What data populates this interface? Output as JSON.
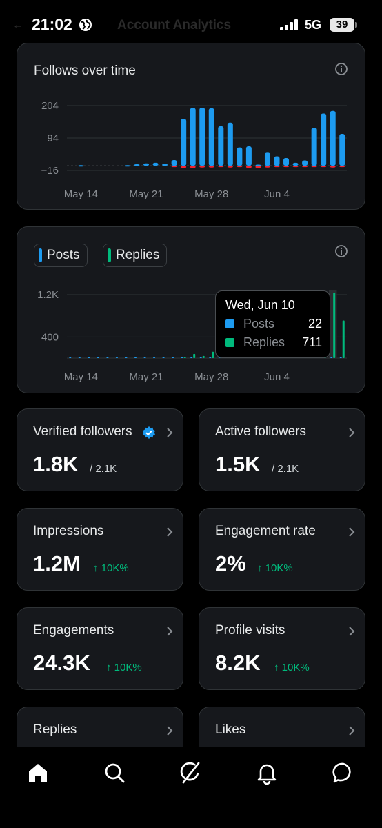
{
  "status_bar": {
    "time": "21:02",
    "network": "5G",
    "battery": "39",
    "obscured_title": "Account Analytics"
  },
  "follows_card": {
    "title": "Follows over time",
    "icon": "info-icon",
    "chart_data": {
      "type": "bar",
      "title": "Follows over time",
      "y_ticks": [
        "204",
        "94",
        "−16"
      ],
      "ylim": [
        -16,
        204
      ],
      "x_ticks": [
        "May 14",
        "May 21",
        "May 28",
        "Jun 4"
      ],
      "dates": [
        "May 13",
        "May 14",
        "May 15",
        "May 16",
        "May 17",
        "May 18",
        "May 19",
        "May 20",
        "May 21",
        "May 22",
        "May 23",
        "May 24",
        "May 25",
        "May 26",
        "May 27",
        "May 28",
        "May 29",
        "May 30",
        "May 31",
        "Jun 1",
        "Jun 2",
        "Jun 3",
        "Jun 4",
        "Jun 5",
        "Jun 6",
        "Jun 7",
        "Jun 8",
        "Jun 9",
        "Jun 10",
        "Jun 11"
      ],
      "series": [
        {
          "color": "#1d9bf0",
          "values": [
            0,
            2,
            0,
            0,
            0,
            0,
            2,
            5,
            8,
            10,
            6,
            19,
            159,
            196,
            197,
            195,
            134,
            146,
            62,
            66,
            4,
            44,
            32,
            26,
            10,
            18,
            129,
            177,
            186,
            108
          ]
        },
        {
          "color": "#f4212e",
          "values": [
            0,
            0,
            0,
            0,
            0,
            0,
            0,
            0,
            0,
            0,
            0,
            -4,
            -8,
            -8,
            -6,
            -6,
            -4,
            -6,
            -4,
            -8,
            -8,
            -6,
            -4,
            -4,
            -4,
            -4,
            -4,
            -4,
            -6,
            -4
          ]
        }
      ],
      "grid": true
    }
  },
  "replies_card": {
    "legend": [
      {
        "label": "Posts",
        "color": "#1d9bf0"
      },
      {
        "label": "Replies",
        "color": "#00ba7c"
      }
    ],
    "icon": "info-icon",
    "tooltip": {
      "date": "Wed, Jun 10",
      "rows": [
        {
          "label": "Posts",
          "value": "22",
          "color": "#1d9bf0"
        },
        {
          "label": "Replies",
          "value": "711",
          "color": "#00ba7c"
        }
      ]
    },
    "chart_data": {
      "type": "bar",
      "y_ticks": [
        "1.2K",
        "400"
      ],
      "ylim": [
        0,
        1200
      ],
      "x_ticks": [
        "May 14",
        "May 21",
        "May 28",
        "Jun 4"
      ],
      "dates": [
        "May 13",
        "May 14",
        "May 15",
        "May 16",
        "May 17",
        "May 18",
        "May 19",
        "May 20",
        "May 21",
        "May 22",
        "May 23",
        "May 24",
        "May 25",
        "May 26",
        "May 27",
        "May 28",
        "May 29",
        "May 30",
        "May 31",
        "Jun 1",
        "Jun 2",
        "Jun 3",
        "Jun 4",
        "Jun 5",
        "Jun 6",
        "Jun 7",
        "Jun 8",
        "Jun 9",
        "Jun 10",
        "Jun 11"
      ],
      "series": [
        {
          "name": "Posts",
          "color": "#1d9bf0",
          "values": [
            4,
            6,
            3,
            4,
            5,
            6,
            4,
            8,
            10,
            6,
            5,
            8,
            12,
            10,
            15,
            12,
            10,
            14,
            16,
            8,
            10,
            12,
            14,
            15,
            16,
            12,
            14,
            18,
            22,
            20
          ]
        },
        {
          "name": "Replies",
          "color": "#00ba7c",
          "values": [
            0,
            0,
            0,
            0,
            0,
            0,
            0,
            0,
            0,
            0,
            0,
            0,
            20,
            80,
            40,
            120,
            60,
            220,
            40,
            30,
            30,
            30,
            30,
            30,
            30,
            30,
            20,
            20,
            1240,
            711
          ]
        }
      ],
      "highlight_index": 28,
      "grid": true
    }
  },
  "metrics": [
    {
      "title": "Verified followers",
      "value": "1.8K",
      "sub": "/ 2.1K",
      "change": "",
      "verified": true
    },
    {
      "title": "Active followers",
      "value": "1.5K",
      "sub": "/ 2.1K",
      "change": "",
      "verified": false
    },
    {
      "title": "Impressions",
      "value": "1.2M",
      "sub": "",
      "change": "↑ 10K%",
      "verified": false
    },
    {
      "title": "Engagement rate",
      "value": "2%",
      "sub": "",
      "change": "↑ 10K%",
      "verified": false
    },
    {
      "title": "Engagements",
      "value": "24.3K",
      "sub": "",
      "change": "↑ 10K%",
      "verified": false
    },
    {
      "title": "Profile visits",
      "value": "8.2K",
      "sub": "",
      "change": "↑ 10K%",
      "verified": false
    },
    {
      "title": "Replies",
      "value": "",
      "sub": "",
      "change": "",
      "verified": false
    },
    {
      "title": "Likes",
      "value": "",
      "sub": "",
      "change": "",
      "verified": false
    }
  ],
  "bottom_nav": [
    {
      "name": "home",
      "icon": "home-icon",
      "active": true
    },
    {
      "name": "search",
      "icon": "search-icon",
      "active": false
    },
    {
      "name": "grok",
      "icon": "grok-icon",
      "active": false
    },
    {
      "name": "notifications",
      "icon": "bell-icon",
      "active": false
    },
    {
      "name": "messages",
      "icon": "message-icon",
      "active": false
    }
  ]
}
